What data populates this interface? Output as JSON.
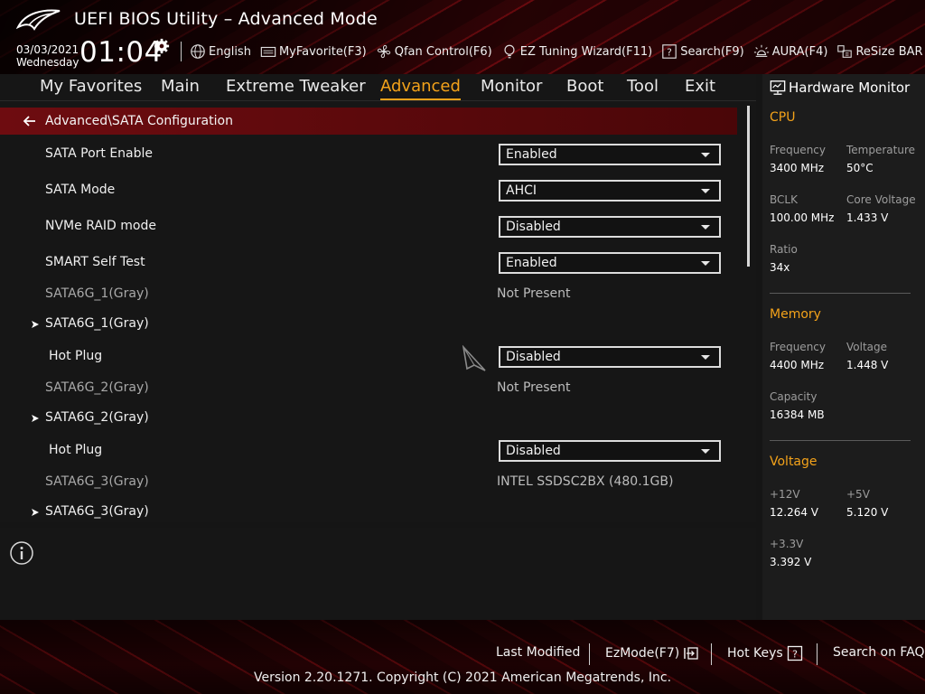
{
  "header": {
    "title": "UEFI BIOS Utility – Advanced Mode",
    "date": "03/03/2021",
    "weekday": "Wednesday",
    "time": "01:04",
    "toolbar": {
      "language": "English",
      "myfavorite": "MyFavorite(F3)",
      "qfan": "Qfan Control(F6)",
      "ez_tuning": "EZ Tuning Wizard(F11)",
      "search": "Search(F9)",
      "aura": "AURA(F4)",
      "resize_bar": "ReSize BAR"
    }
  },
  "nav": {
    "tabs": [
      {
        "label": "My Favorites"
      },
      {
        "label": "Main"
      },
      {
        "label": "Extreme Tweaker"
      },
      {
        "label": "Advanced",
        "active": true
      },
      {
        "label": "Monitor"
      },
      {
        "label": "Boot"
      },
      {
        "label": "Tool"
      },
      {
        "label": "Exit"
      }
    ]
  },
  "main": {
    "breadcrumb": "Advanced\\SATA Configuration",
    "rows": [
      {
        "label": "SATA Port Enable",
        "value": "Enabled",
        "kind": "select"
      },
      {
        "label": "SATA Mode",
        "value": "AHCI",
        "kind": "select"
      },
      {
        "label": "NVMe RAID mode",
        "value": "Disabled",
        "kind": "select"
      },
      {
        "label": "SMART Self Test",
        "value": "Enabled",
        "kind": "select"
      },
      {
        "label": "SATA6G_1(Gray)",
        "value": "Not Present",
        "kind": "info"
      },
      {
        "label": "SATA6G_1(Gray)",
        "kind": "submenu"
      },
      {
        "label": "Hot Plug",
        "value": "Disabled",
        "kind": "select"
      },
      {
        "label": "SATA6G_2(Gray)",
        "value": "Not Present",
        "kind": "info"
      },
      {
        "label": "SATA6G_2(Gray)",
        "kind": "submenu"
      },
      {
        "label": "Hot Plug",
        "value": "Disabled",
        "kind": "select"
      },
      {
        "label": "SATA6G_3(Gray)",
        "value": "INTEL SSDSC2BX (480.1GB)",
        "kind": "info"
      },
      {
        "label": "SATA6G_3(Gray)",
        "kind": "submenu"
      }
    ]
  },
  "hw_monitor": {
    "title": "Hardware Monitor",
    "cpu": {
      "heading": "CPU",
      "frequency_label": "Frequency",
      "frequency": "3400 MHz",
      "temperature_label": "Temperature",
      "temperature": "50°C",
      "bclk_label": "BCLK",
      "bclk": "100.00 MHz",
      "core_voltage_label": "Core Voltage",
      "core_voltage": "1.433 V",
      "ratio_label": "Ratio",
      "ratio": "34x"
    },
    "memory": {
      "heading": "Memory",
      "frequency_label": "Frequency",
      "frequency": "4400 MHz",
      "voltage_label": "Voltage",
      "voltage": "1.448 V",
      "capacity_label": "Capacity",
      "capacity": "16384 MB"
    },
    "voltage": {
      "heading": "Voltage",
      "v12_label": "+12V",
      "v12": "12.264 V",
      "v5_label": "+5V",
      "v5": "5.120 V",
      "v33_label": "+3.3V",
      "v33": "3.392 V"
    }
  },
  "footer": {
    "last_modified": "Last Modified",
    "ezmode": "EzMode(F7)",
    "hot_keys": "Hot Keys",
    "search_faq": "Search on FAQ",
    "copyright": "Version 2.20.1271. Copyright (C) 2021 American Megatrends, Inc."
  },
  "colors": {
    "accent": "#f3a21a",
    "breadcrumb_bg": "#6e0c10",
    "panel_bg": "#161616",
    "hw_panel_bg": "#1c1c1c"
  }
}
